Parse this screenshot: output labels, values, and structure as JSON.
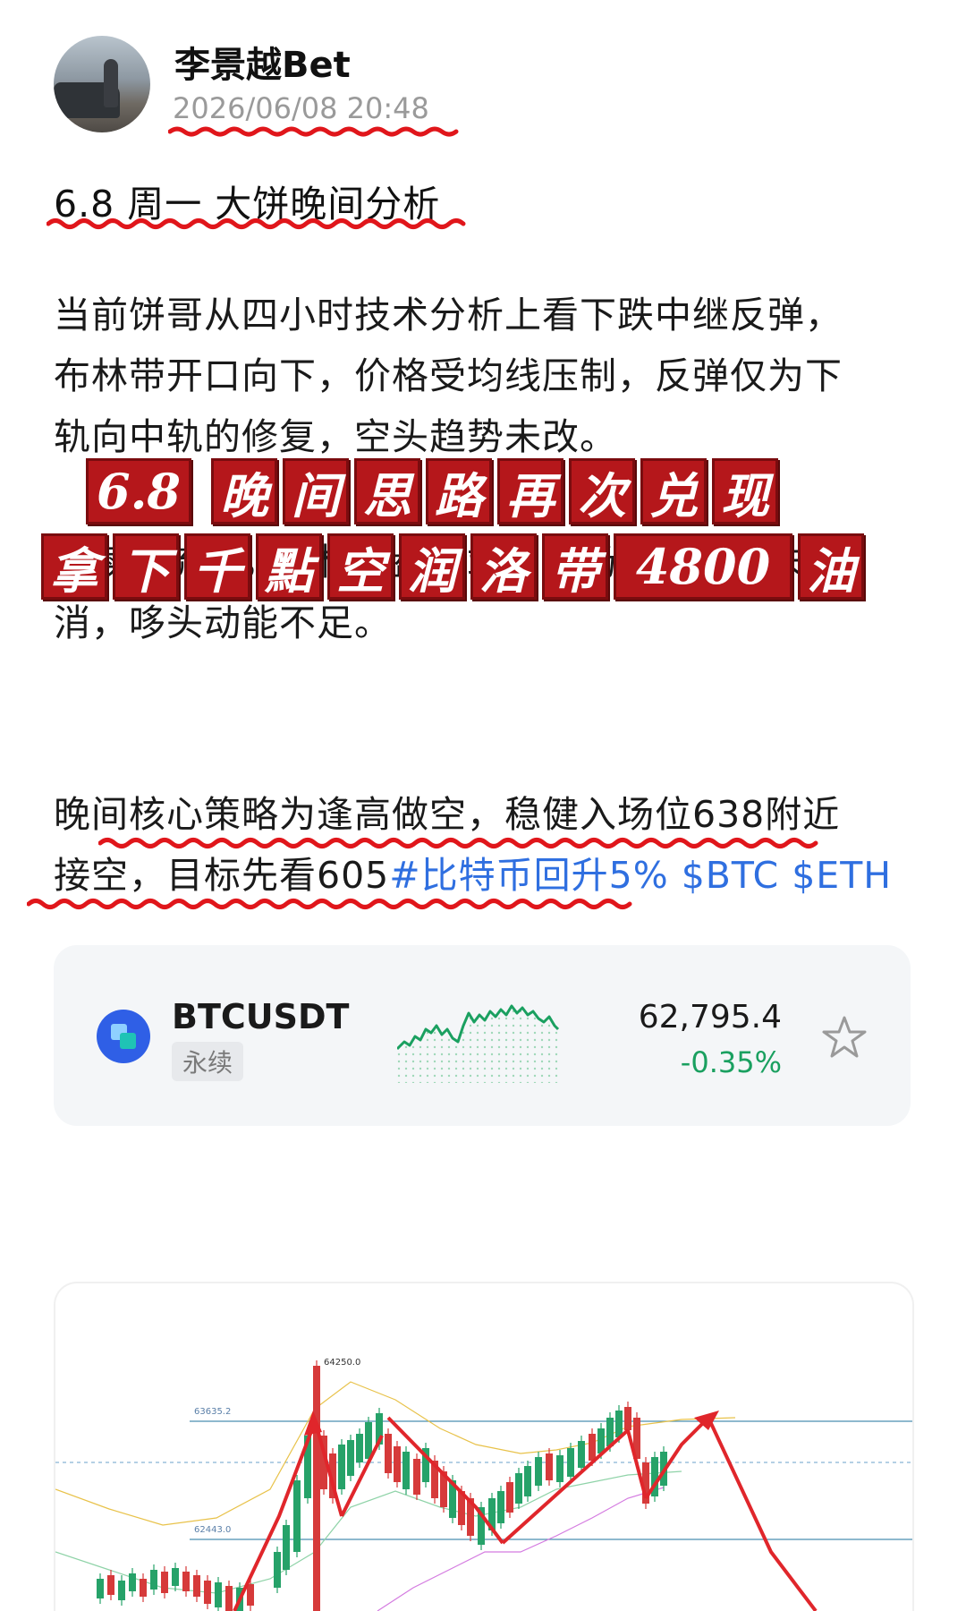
{
  "author": {
    "name": "李景越Bet",
    "timestamp": "2026/06/08 20:48"
  },
  "post": {
    "title": "6.8  周一  大饼晚间分析",
    "para1": [
      "当前饼哥从四小时技术分析上看下跌中继反弹，",
      "布林带开口向下，价格受均线压制，反弹仅为下",
      "轨向中轨的修复，空头趋势未改。"
    ],
    "para2": [
      "",
      "持续净流出，机构买盘枯竭，市场恐慌情绪未",
      "消，哆头动能不足。"
    ],
    "strategy_line1": "晚间核心策略为逢高做空，稳健入场位638附近",
    "strategy_line2": "接空，目标先看605",
    "hashtags": "#比特币回升5% $BTC $ETH"
  },
  "stamp": {
    "line1": [
      "6.8",
      " ",
      "晚",
      "间",
      "思",
      "路",
      "再",
      "次",
      "兑",
      "现"
    ],
    "line2": [
      "拿",
      "下",
      "千",
      "點",
      "空",
      "润",
      "洛",
      "带",
      "4800",
      "油"
    ]
  },
  "ticker": {
    "symbol": "BTCUSDT",
    "contract_type": "永续",
    "price": "62,795.4",
    "change": "-0.35%",
    "colors": {
      "up": "#1aa060",
      "brand": "#2f5fe6"
    },
    "icons": [
      "coin-icon",
      "star-icon"
    ]
  },
  "chart_data": {
    "type": "candlestick",
    "annotations": {
      "high_label": "64250.0",
      "level_upper": "63635.2",
      "level_lower": "62443.0"
    },
    "levels": [
      63635.2,
      62443.0
    ],
    "high": 64250.0
  }
}
